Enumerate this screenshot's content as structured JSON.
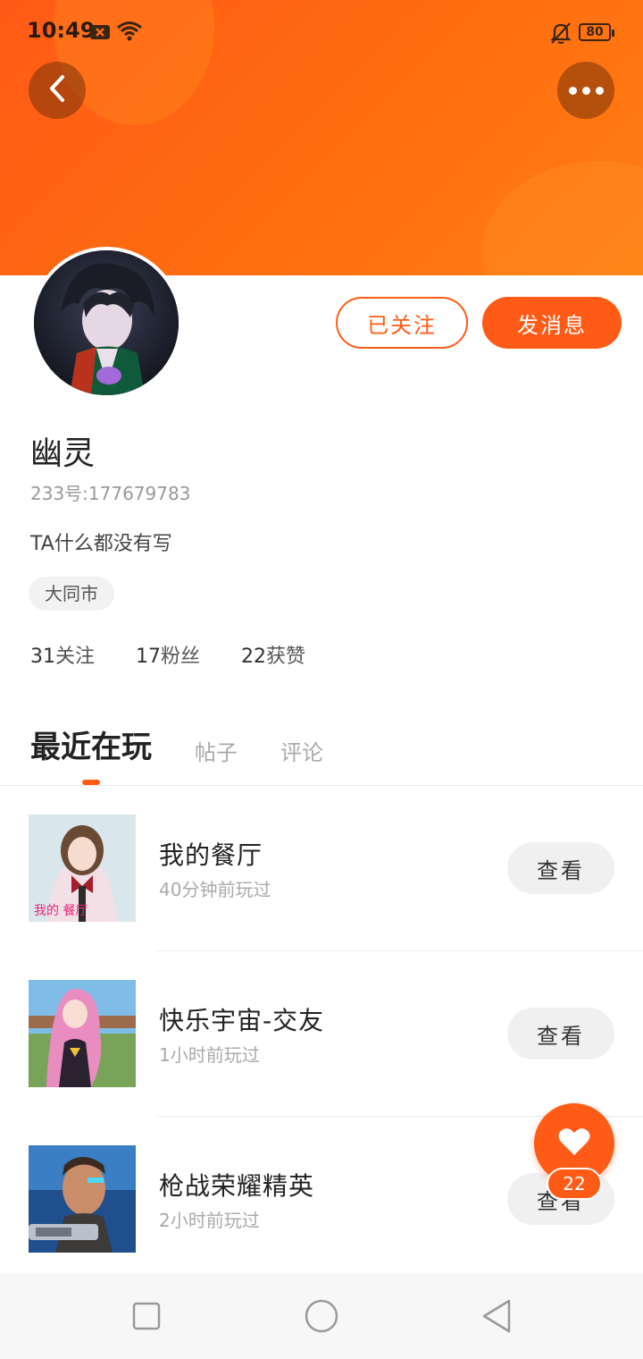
{
  "status_bar": {
    "time": "10:49",
    "battery": "80"
  },
  "header": {
    "back_icon": "chevron-left-icon",
    "more_icon": "more-dots-icon"
  },
  "profile": {
    "follow_label": "已关注",
    "message_label": "发消息",
    "nickname": "幽灵",
    "uid": "233号:177679783",
    "bio": "TA什么都没有写",
    "city": "大同市",
    "stats": [
      {
        "num": "31",
        "label": "关注"
      },
      {
        "num": "17",
        "label": "粉丝"
      },
      {
        "num": "22",
        "label": "获赞"
      }
    ]
  },
  "tabs": [
    {
      "label": "最近在玩",
      "active": true
    },
    {
      "label": "帖子",
      "active": false
    },
    {
      "label": "评论",
      "active": false
    }
  ],
  "games": [
    {
      "name": "我的餐厅",
      "time": "40分钟前玩过",
      "button": "查看"
    },
    {
      "name": "快乐宇宙-交友",
      "time": "1小时前玩过",
      "button": "查看"
    },
    {
      "name": "枪战荣耀精英",
      "time": "2小时前玩过",
      "button": "查看"
    }
  ],
  "like_fab": {
    "count": "22"
  },
  "colors": {
    "accent": "#ff5a16"
  }
}
